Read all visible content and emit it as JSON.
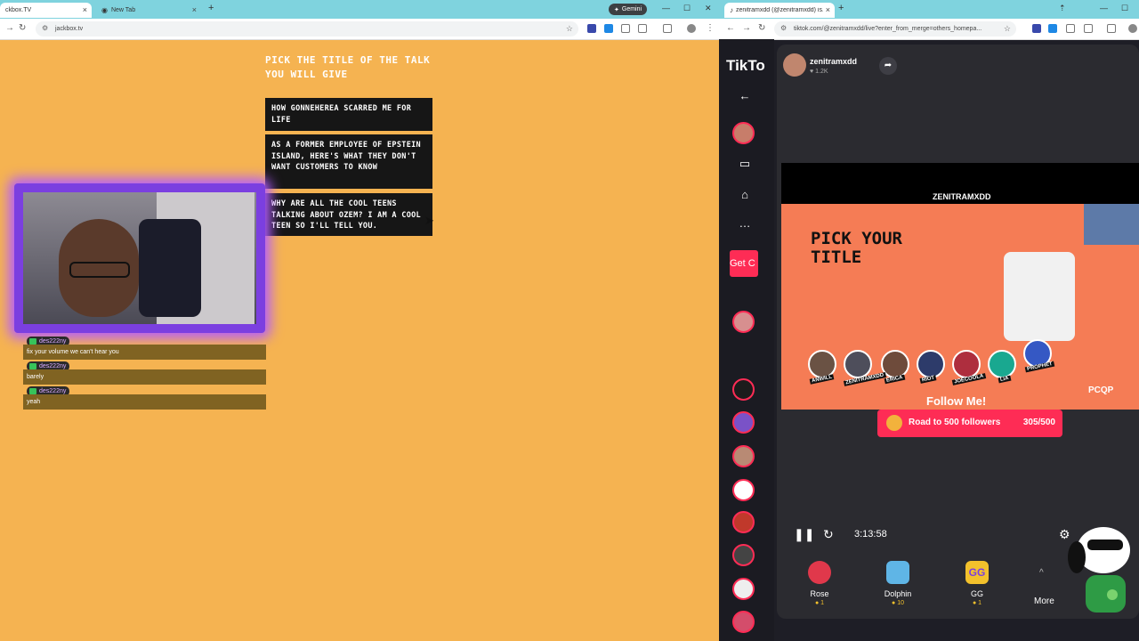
{
  "left_window": {
    "tabs": [
      {
        "title": "ckbox.TV",
        "active": true
      },
      {
        "title": "New Tab",
        "active": false
      }
    ],
    "gemini_label": "Gemini",
    "url": "jackbox.tv"
  },
  "jackbox": {
    "prompt": "PICK THE TITLE OF THE TALK YOU WILL GIVE",
    "choices": [
      "HOW GONNEHEREA SCARRED ME FOR LIFE",
      "AS A FORMER EMPLOYEE OF EPSTEIN ISLAND, HERE'S WHAT THEY DON'T WANT CUSTOMERS TO KNOW",
      "WHY ARE ALL THE COOL TEENS TALKING ABOUT OZEM? I AM A COOL TEEN SO I'LL TELL YOU."
    ]
  },
  "chat": [
    {
      "user": "des222ny",
      "message": "fix your volume we can't hear you"
    },
    {
      "user": "des222ny",
      "message": "barely"
    },
    {
      "user": "des222ny",
      "message": "yeah"
    }
  ],
  "right_window": {
    "tab_title": "zenitramxdd (@zenitramxdd) is...",
    "url": "tiktok.com/@zenitramxdd/live?enter_from_merge=others_homepa..."
  },
  "tiktok": {
    "logo": "TikTo",
    "get_coins": "Get C",
    "host": {
      "name": "zenitramxdd",
      "likes": "1.2K"
    },
    "stream": {
      "streamer_label": "ZENITRAMXDD",
      "game_title": "PICK YOUR TITLE",
      "players": [
        "ANWILL",
        "ZENITRAMXDD",
        "ERICA",
        "RIOT",
        "JOECOOLA",
        "LIA",
        "PROPHET"
      ],
      "follow_text": "Follow Me!",
      "brand": "PCQP"
    },
    "goal": {
      "label": "Road to 500 followers",
      "progress": "305/500"
    },
    "time": "3:13:58",
    "gifts": [
      {
        "name": "Rose",
        "cost": "1"
      },
      {
        "name": "Dolphin",
        "cost": "10"
      },
      {
        "name": "GG",
        "cost": "1"
      }
    ],
    "more": "More"
  },
  "colors": {
    "jackbox_bg": "#f5b351",
    "tiktok_red": "#fe2c55",
    "chrome_tabstrip": "#7fd3de"
  }
}
